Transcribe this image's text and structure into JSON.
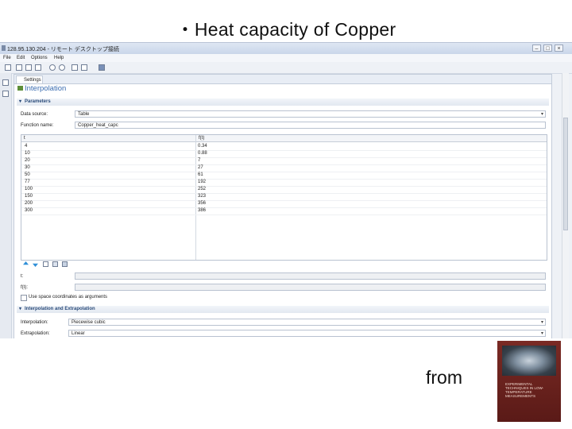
{
  "slide": {
    "title": "・Heat capacity of Copper",
    "source_label": "from",
    "book_cover_text": "EXPERIMENTAL TECHNIQUES IN LOW-TEMPERATURE MEASUREMENTS"
  },
  "window": {
    "title": "128.95.130.204 - リモート デスクトップ接続",
    "controls": [
      "–",
      "□",
      "×"
    ]
  },
  "menu": [
    "File",
    "Edit",
    "Options",
    "Help"
  ],
  "toolbar_icons": [
    "new-icon",
    "open-icon",
    "save-icon",
    "save-as-icon",
    "undo-icon",
    "redo-icon",
    "copy-icon",
    "paste-icon",
    "user-icon"
  ],
  "settings": {
    "tab_label": "Settings",
    "heading": "Interpolation",
    "parameters_section": "Parameters",
    "data_source_label": "Data source:",
    "data_source_value": "Table",
    "function_name_label": "Function name:",
    "function_name_value": "Copper_heat_capc",
    "table": {
      "headers": [
        "t",
        "f(t)"
      ],
      "rows": [
        [
          "4",
          "0.34"
        ],
        [
          "10",
          "0.88"
        ],
        [
          "20",
          "7"
        ],
        [
          "30",
          "27"
        ],
        [
          "50",
          "61"
        ],
        [
          "77",
          "192"
        ],
        [
          "100",
          "252"
        ],
        [
          "150",
          "323"
        ],
        [
          "200",
          "356"
        ],
        [
          "300",
          "386"
        ]
      ]
    },
    "t_label": "t:",
    "ft_label": "f(t):",
    "use_space_label": "Use space coordinates as arguments",
    "interp_section": "Interpolation and Extrapolation",
    "interpolation_label": "Interpolation:",
    "interpolation_value": "Piecewise cubic",
    "extrapolation_label": "Extrapolation:",
    "extrapolation_value": "Linear"
  },
  "colors": {
    "accent": "#3a6cb0",
    "panel_bg": "#eef1f6",
    "cover": "#6a221d"
  }
}
